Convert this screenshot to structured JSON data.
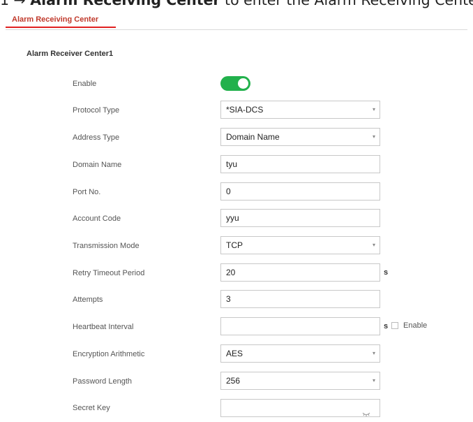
{
  "doc_header": {
    "prefix": "1 → ",
    "bold": "Alarm Receiving Center",
    "suffix": " to enter the Alarm Receiving Center page."
  },
  "tabs": [
    {
      "label": "Alarm Receiving Center",
      "active": true
    }
  ],
  "section_title": "Alarm Receiver Center1",
  "form": {
    "enable": {
      "label": "Enable",
      "value": true,
      "color": "#22b14c"
    },
    "protocol_type": {
      "label": "Protocol Type",
      "value": "*SIA-DCS"
    },
    "address_type": {
      "label": "Address Type",
      "value": "Domain Name"
    },
    "domain_name": {
      "label": "Domain Name",
      "value": "tyu"
    },
    "port_no": {
      "label": "Port No.",
      "value": "0"
    },
    "account_code": {
      "label": "Account Code",
      "value": "yyu"
    },
    "transmission_mode": {
      "label": "Transmission Mode",
      "value": "TCP"
    },
    "retry_timeout": {
      "label": "Retry Timeout Period",
      "value": "20",
      "unit": "s"
    },
    "attempts": {
      "label": "Attempts",
      "value": "3"
    },
    "heartbeat_interval": {
      "label": "Heartbeat Interval",
      "value": "",
      "unit": "s",
      "enable_label": "Enable",
      "enable_checked": false
    },
    "encryption": {
      "label": "Encryption Arithmetic",
      "value": "AES"
    },
    "password_length": {
      "label": "Password Length",
      "value": "256"
    },
    "secret_key": {
      "label": "Secret Key",
      "value": ""
    }
  },
  "colors": {
    "accent": "#e02020",
    "toggle_on": "#22b14c"
  }
}
